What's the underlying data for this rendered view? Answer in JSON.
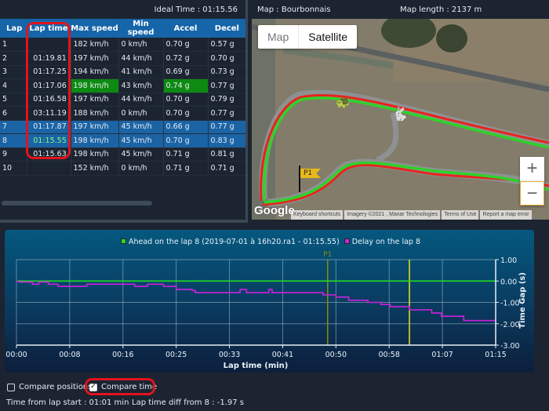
{
  "lap_table": {
    "ideal_time": "Ideal Time : 01:15.56",
    "columns": [
      "Lap",
      "Lap time",
      "Max speed",
      "Min speed",
      "Accel",
      "Decel"
    ],
    "rows": [
      {
        "lap": "1",
        "lap_time": "",
        "max_speed": "182 km/h",
        "min_speed": "0 km/h",
        "accel": "0.70 g",
        "decel": "0.57 g"
      },
      {
        "lap": "2",
        "lap_time": "01:19.81",
        "max_speed": "197 km/h",
        "min_speed": "44 km/h",
        "accel": "0.72 g",
        "decel": "0.70 g"
      },
      {
        "lap": "3",
        "lap_time": "01:17.25",
        "max_speed": "194 km/h",
        "min_speed": "41 km/h",
        "accel": "0.69 g",
        "decel": "0.73 g"
      },
      {
        "lap": "4",
        "lap_time": "01:17.06",
        "max_speed": "198 km/h",
        "min_speed": "43 km/h",
        "accel": "0.74 g",
        "decel": "0.77 g"
      },
      {
        "lap": "5",
        "lap_time": "01:16.58",
        "max_speed": "197 km/h",
        "min_speed": "44 km/h",
        "accel": "0.70 g",
        "decel": "0.79 g"
      },
      {
        "lap": "6",
        "lap_time": "03:11.19",
        "max_speed": "188 km/h",
        "min_speed": "0 km/h",
        "accel": "0.70 g",
        "decel": "0.77 g"
      },
      {
        "lap": "7",
        "lap_time": "01:17.87",
        "max_speed": "197 km/h",
        "min_speed": "45 km/h",
        "accel": "0.66 g",
        "decel": "0.77 g"
      },
      {
        "lap": "8",
        "lap_time": "01:15.55",
        "max_speed": "198 km/h",
        "min_speed": "45 km/h",
        "accel": "0.70 g",
        "decel": "0.83 g"
      },
      {
        "lap": "9",
        "lap_time": "01:15.63",
        "max_speed": "198 km/h",
        "min_speed": "45 km/h",
        "accel": "0.71 g",
        "decel": "0.81 g"
      },
      {
        "lap": "10",
        "lap_time": "",
        "max_speed": "152 km/h",
        "min_speed": "0 km/h",
        "accel": "0.71 g",
        "decel": "0.71 g"
      }
    ],
    "selected_laps": [
      "7",
      "8"
    ],
    "best_cells": [
      {
        "lap": "4",
        "column": "max_speed"
      },
      {
        "lap": "4",
        "column": "accel"
      },
      {
        "lap": "8",
        "column": "lap_time"
      },
      {
        "lap": "8",
        "column": "decel"
      }
    ],
    "colors": {
      "header": "#1565a8",
      "selected_row": "#1a63a5",
      "best": "#0d8a12"
    }
  },
  "map": {
    "name": "Map : Bourbonnais",
    "length": "Map length : 2137 m",
    "type_map_label": "Map",
    "type_satellite_label": "Satellite",
    "active_type": "Satellite",
    "zoom_in_label": "+",
    "zoom_out_label": "−",
    "google_logo": "Google",
    "attribution": [
      "Keyboard shortcuts",
      "Imagery ©2021 , Maxar Technologies",
      "Terms of Use",
      "Report a map error"
    ],
    "markers": {
      "turtle": "🐢",
      "rabbit": "🐇",
      "flag_label": "P1"
    },
    "colors": {
      "trace_green": "#2fd12a",
      "trace_red": "#e8231e"
    }
  },
  "chart_data": {
    "type": "line",
    "legend": [
      {
        "name": "Ahead on the lap 8 (2019-07-01 à 16h20.ra1 - 01:15.55)",
        "color": "#22dd22"
      },
      {
        "name": "Delay on the lap 8",
        "color": "#cc22dd"
      }
    ],
    "xlabel": "Lap time (min)",
    "ylabel": "Time Gap (s)",
    "x_tick_labels": [
      "00:00",
      "00:08",
      "00:16",
      "00:25",
      "00:33",
      "00:41",
      "00:50",
      "00:58",
      "01:07",
      "01:15"
    ],
    "x_range_seconds": [
      0,
      75
    ],
    "y_tick_labels": [
      "1.00",
      "0.00",
      "-1.00",
      "-2.00",
      "-3.00"
    ],
    "ylim": [
      -3,
      1
    ],
    "grid": true,
    "legend_position": "top-center",
    "markers": [
      {
        "label": "P1",
        "x_seconds": 48.7,
        "color": "#8a8a10"
      },
      {
        "label": "",
        "x_seconds": 61.5,
        "color": "#e8e81a"
      }
    ],
    "series": [
      {
        "name": "Ahead on the lap 8",
        "color": "#22dd22",
        "points": [
          [
            0,
            0.0
          ],
          [
            75,
            0.0
          ]
        ]
      },
      {
        "name": "Delay on the lap 8",
        "color": "#cc22dd",
        "points": [
          [
            0,
            0.0
          ],
          [
            0.5,
            -0.05
          ],
          [
            2.5,
            -0.05
          ],
          [
            2.5,
            -0.15
          ],
          [
            3.5,
            -0.15
          ],
          [
            3.5,
            -0.05
          ],
          [
            5,
            -0.05
          ],
          [
            5,
            -0.15
          ],
          [
            6.5,
            -0.15
          ],
          [
            6.5,
            -0.25
          ],
          [
            11,
            -0.25
          ],
          [
            11,
            -0.15
          ],
          [
            18.5,
            -0.15
          ],
          [
            18.5,
            -0.25
          ],
          [
            20.5,
            -0.25
          ],
          [
            20.5,
            -0.15
          ],
          [
            23,
            -0.15
          ],
          [
            23,
            -0.25
          ],
          [
            25,
            -0.25
          ],
          [
            25,
            -0.4
          ],
          [
            27.5,
            -0.4
          ],
          [
            27.5,
            -0.45
          ],
          [
            28,
            -0.45
          ],
          [
            28,
            -0.55
          ],
          [
            35,
            -0.55
          ],
          [
            35,
            -0.4
          ],
          [
            36,
            -0.4
          ],
          [
            36,
            -0.55
          ],
          [
            39.5,
            -0.55
          ],
          [
            39.5,
            -0.4
          ],
          [
            40,
            -0.4
          ],
          [
            40,
            -0.55
          ],
          [
            48,
            -0.55
          ],
          [
            48,
            -0.65
          ],
          [
            50,
            -0.65
          ],
          [
            50,
            -0.75
          ],
          [
            52,
            -0.75
          ],
          [
            52,
            -0.9
          ],
          [
            55,
            -0.9
          ],
          [
            55,
            -1.0
          ],
          [
            57,
            -1.0
          ],
          [
            57,
            -1.1
          ],
          [
            58.5,
            -1.1
          ],
          [
            58.5,
            -1.2
          ],
          [
            61.5,
            -1.2
          ],
          [
            61.5,
            -1.35
          ],
          [
            65,
            -1.35
          ],
          [
            65,
            -1.5
          ],
          [
            66.5,
            -1.5
          ],
          [
            66.5,
            -1.65
          ],
          [
            70,
            -1.65
          ],
          [
            70,
            -1.85
          ],
          [
            75,
            -1.85
          ]
        ]
      }
    ]
  },
  "controls": {
    "compare_positions": {
      "label": "Compare positions",
      "checked": false
    },
    "compare_time": {
      "label": "Compare time",
      "checked": true
    },
    "time_from_lap_start": "Time from lap start : 01:01 min",
    "lap_time_diff": "Lap time diff from 8 : -1.97 s"
  }
}
